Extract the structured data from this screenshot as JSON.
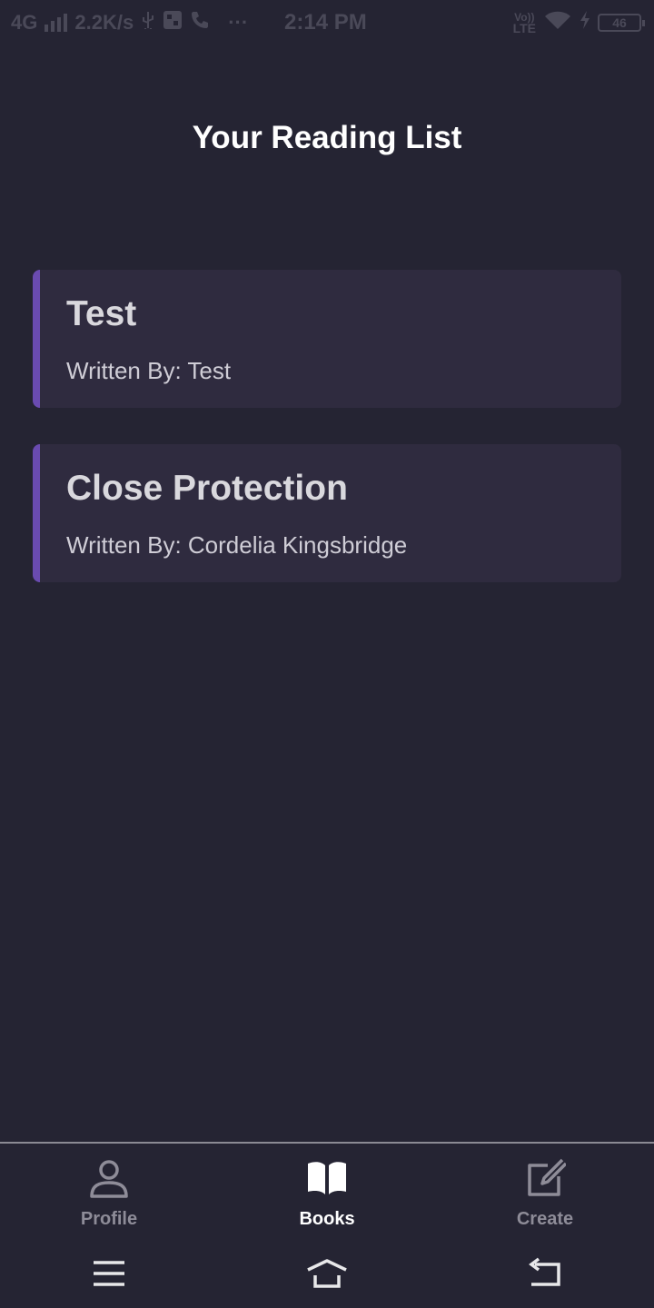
{
  "status_bar": {
    "network": "4G",
    "speed": "2.2K/s",
    "more": "···",
    "time": "2:14 PM",
    "volte": "Vo))",
    "lte": "LTE",
    "battery": "46"
  },
  "page": {
    "title": "Your Reading List"
  },
  "books": [
    {
      "title": "Test",
      "author": "Written By: Test"
    },
    {
      "title": "Close Protection",
      "author": "Written By: Cordelia Kingsbridge"
    }
  ],
  "tabs": [
    {
      "label": "Profile",
      "icon": "person-icon",
      "active": false
    },
    {
      "label": "Books",
      "icon": "open-book-icon",
      "active": true
    },
    {
      "label": "Create",
      "icon": "edit-square-icon",
      "active": false
    }
  ],
  "colors": {
    "background": "#252433",
    "card": "#2f2b3f",
    "accent": "#6a4bb0"
  }
}
